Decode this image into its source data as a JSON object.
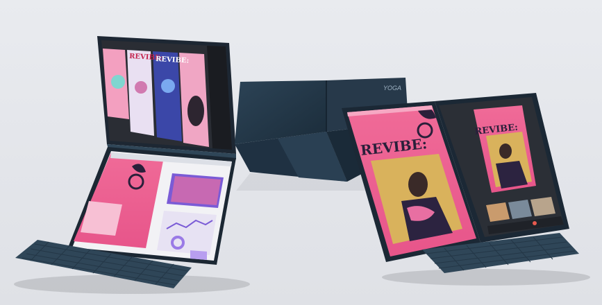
{
  "scene": {
    "description_free": true,
    "brand_mark": "YOGA",
    "poster_headline_top_a": "REVIBE:",
    "poster_headline_top_b": "REVIBE:",
    "poster_headline_main": "REVIBE:",
    "poster_headline_right": "REVIBE:"
  },
  "colors": {
    "background": "#e5e7eb",
    "device_navy": "#24384a",
    "device_navy_dark": "#172634",
    "keyboard": "#2f4658",
    "poster_pink": "#ee5b8d",
    "poster_pink_light": "#f6a8c3",
    "accent_purple": "#7a5bd6",
    "screen_dark": "#1a1d23"
  }
}
